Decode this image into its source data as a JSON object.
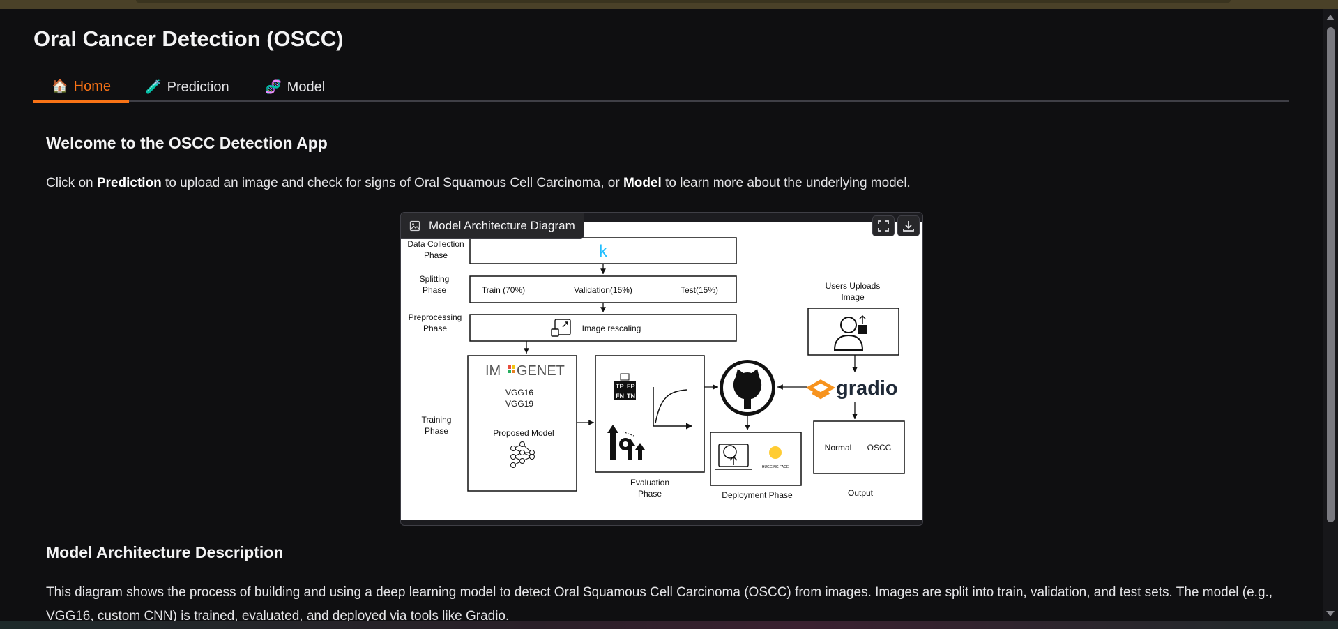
{
  "app": {
    "title": "Oral Cancer Detection (OSCC)"
  },
  "tabs": [
    {
      "icon": "🏠",
      "label": "Home",
      "active": true
    },
    {
      "icon": "🧪",
      "label": "Prediction",
      "active": false
    },
    {
      "icon": "🧬",
      "label": "Model",
      "active": false
    }
  ],
  "home": {
    "welcome_heading": "Welcome to the OSCC Detection App",
    "intro": {
      "p1": "Click on ",
      "b1": "Prediction",
      "p2": " to upload an image and check for signs of Oral Squamous Cell Carcinoma, or ",
      "b2": "Model",
      "p3": " to learn more about the underlying model."
    },
    "diagram_card": {
      "label": "Model Architecture Diagram",
      "icons": {
        "label": "image-icon",
        "fullscreen": "fullscreen-icon",
        "download": "download-icon"
      }
    },
    "description_heading": "Model Architecture Description",
    "description_text": "This diagram shows the process of building and using a deep learning model to detect Oral Squamous Cell Carcinoma (OSCC) from images. Images are split into train, validation, and test sets. The model (e.g., VGG16, custom CNN) is trained, evaluated, and deployed via tools like Gradio."
  },
  "diagram": {
    "phases": {
      "data_collection": [
        "Data Collection",
        "Phase"
      ],
      "splitting": [
        "Splitting",
        "Phase"
      ],
      "preprocessing": [
        "Preprocessing",
        "Phase"
      ],
      "training": [
        "Training",
        "Phase"
      ],
      "evaluation": [
        "Evaluation",
        "Phase"
      ],
      "deployment": "Deployment Phase",
      "output": "Output"
    },
    "kaggle_k": "k",
    "split": {
      "train": "Train (70%)",
      "validation": "Validation(15%)",
      "test": "Test(15%)"
    },
    "rescaling": "Image rescaling",
    "imagenet": {
      "pre": "IM",
      "post": "GENET"
    },
    "models": [
      "VGG16",
      "VGG19"
    ],
    "proposed_model": "Proposed Model",
    "confusion": [
      "TP",
      "FP",
      "FN",
      "TN"
    ],
    "users_upload": [
      "Users Uploads",
      "Image"
    ],
    "gradio": "gradio",
    "hugging_face": "HUGGING FACE",
    "output_classes": [
      "Normal",
      "OSCC"
    ],
    "colors": {
      "kaggle": "#20beff",
      "gradio": "#f7931e"
    }
  }
}
